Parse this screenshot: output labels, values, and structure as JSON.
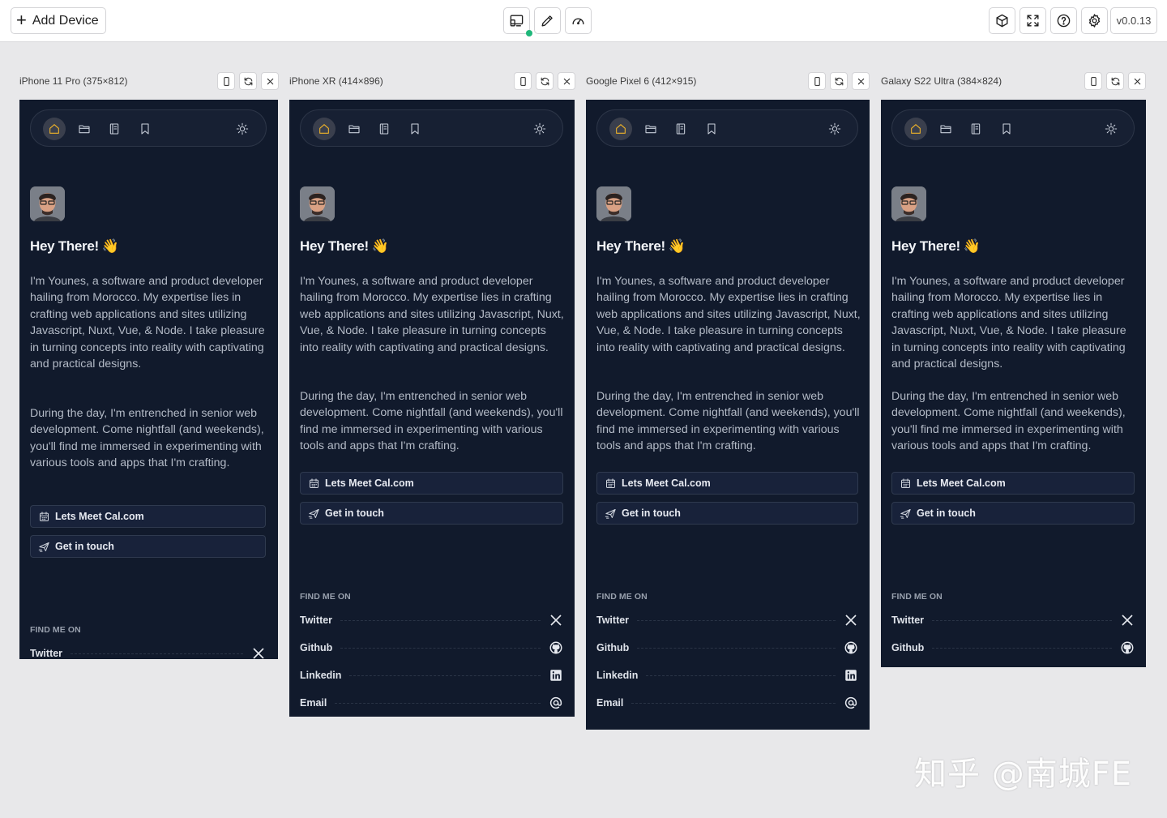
{
  "toolbar": {
    "add_device_label": "Add Device",
    "version": "v0.0.13",
    "center_icons": [
      "device-select-icon",
      "pen-icon",
      "gauge-icon"
    ],
    "right_icons": [
      "cube-icon",
      "expand-icon",
      "help-icon",
      "settings-icon"
    ]
  },
  "content": {
    "greeting": "Hey There!",
    "wave": "👋",
    "para1": "I'm Younes, a software and product developer hailing from Morocco. My expertise lies in crafting web applications and sites utilizing Javascript, Nuxt, Vue, & Node. I take pleasure in turning concepts into reality with captivating and practical designs.",
    "para2": "During the day, I'm entrenched in senior web development. Come nightfall (and weekends), you'll find me immersed in experimenting with various tools and apps that I'm crafting.",
    "cta_meet": "Lets Meet Cal.com",
    "cta_touch": "Get in touch",
    "find_me": "FIND ME ON",
    "socials": [
      "Twitter",
      "Github",
      "Linkedin",
      "Email"
    ]
  },
  "devices": [
    {
      "title": "iPhone 11 Pro (375×812)"
    },
    {
      "title": "iPhone XR (414×896)"
    },
    {
      "title": "Google Pixel 6 (412×915)"
    },
    {
      "title": "Galaxy S22 Ultra (384×824)"
    }
  ],
  "watermark": "知乎 @南城FE",
  "colors": {
    "screen_bg": "#111a2c",
    "active_nav": "#f0b429",
    "status_dot": "#1fb77a"
  }
}
